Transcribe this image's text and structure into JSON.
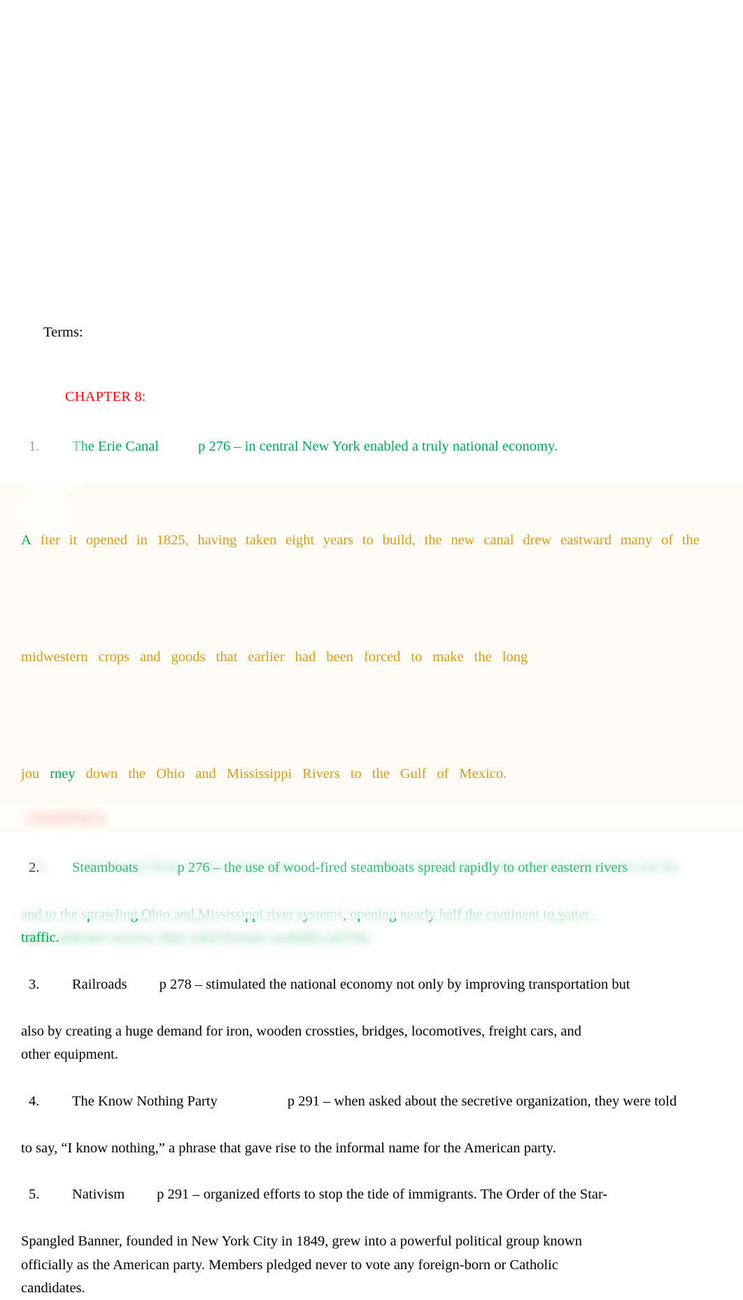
{
  "document": {
    "terms_label": "Terms:",
    "chapter_heading": "CHAPTER 8:"
  },
  "colors": {
    "green": "#00a550",
    "orange": "#d79a1b",
    "red": "#ff0000",
    "black": "#000000",
    "highlight": "#fdfcf4",
    "page_background": "#ffffff"
  },
  "terms": [
    {
      "number": "1.",
      "title": "The Erie Canal",
      "page_ref": "p 276 – in central New York enabled a truly national economy.",
      "color": "green",
      "body_color": "orange",
      "body_lines": [
        [
          "After",
          "it",
          "opened",
          "in",
          "1825,",
          "having",
          "taken",
          "eight",
          "years",
          "to",
          "build,",
          "the",
          "new",
          "canal",
          "drew",
          "eastward",
          "many",
          "of",
          "the"
        ],
        [
          "midwestern",
          "crops",
          "and",
          "goods",
          "that",
          "earlier",
          "had",
          "been",
          "forced",
          "to",
          "make",
          "the",
          "long"
        ],
        [
          "jou",
          "rney",
          "down",
          "the",
          "Ohio",
          "and",
          "Mississippi",
          "Rivers",
          "to",
          "the",
          "Gulf",
          "of",
          "Mexico."
        ]
      ],
      "body_first_letter": "A",
      "body_first_rest": "fter",
      "body_green_word": "rney"
    },
    {
      "number": "2.",
      "title": "Steamboats",
      "page_ref": "p 276 – the use of wood-fired steamboats spread rapidly to other eastern rivers",
      "color": "green",
      "body_color": "green",
      "continuation": [
        "and to the sprawling Ohio and Mississippi river systems, opening nearly half the continent to water",
        "traffic."
      ]
    },
    {
      "number": "3.",
      "title": "Railroads",
      "page_ref": "p 278 – stimulated the national economy not only by improving transportation but",
      "color": "black",
      "body_color": "black",
      "continuation": [
        "also by creating a huge demand for iron, wooden crossties, bridges, locomotives, freight cars, and",
        "other equipment."
      ]
    },
    {
      "number": "4.",
      "title": "The Know Nothing Party",
      "page_ref": "p 291 – when asked about the secretive organization, they were told",
      "color": "black",
      "body_color": "black",
      "continuation": [
        "to say, “I know nothing,” a phrase that gave rise to the informal name for the American party."
      ]
    },
    {
      "number": "5.",
      "title": "Nativism",
      "page_ref": "p 291 – organized efforts to stop the tide of immigrants. The Order of the Star-",
      "color": "black",
      "body_color": "black",
      "continuation": [
        "Spangled Banner, founded in New York City in 1849, grew into a powerful political group known",
        "officially as the American party. Members pledged never to vote any foreign-born or Catholic",
        "candidates."
      ]
    }
  ],
  "blurred_section": {
    "note": "text is obscured by heavy blur in the source image",
    "chapter_heading": "CHAPTER 9:",
    "number": "1.",
    "title": "The Second Bank of the United States",
    "page_ref": "p 302 – the balance of the economy flourished and the",
    "lines": [
      "balance in a bank began trading on a stabilized market. The debt was decided peaceably to support a",
      "stable national currency that could become available and fair."
    ]
  }
}
